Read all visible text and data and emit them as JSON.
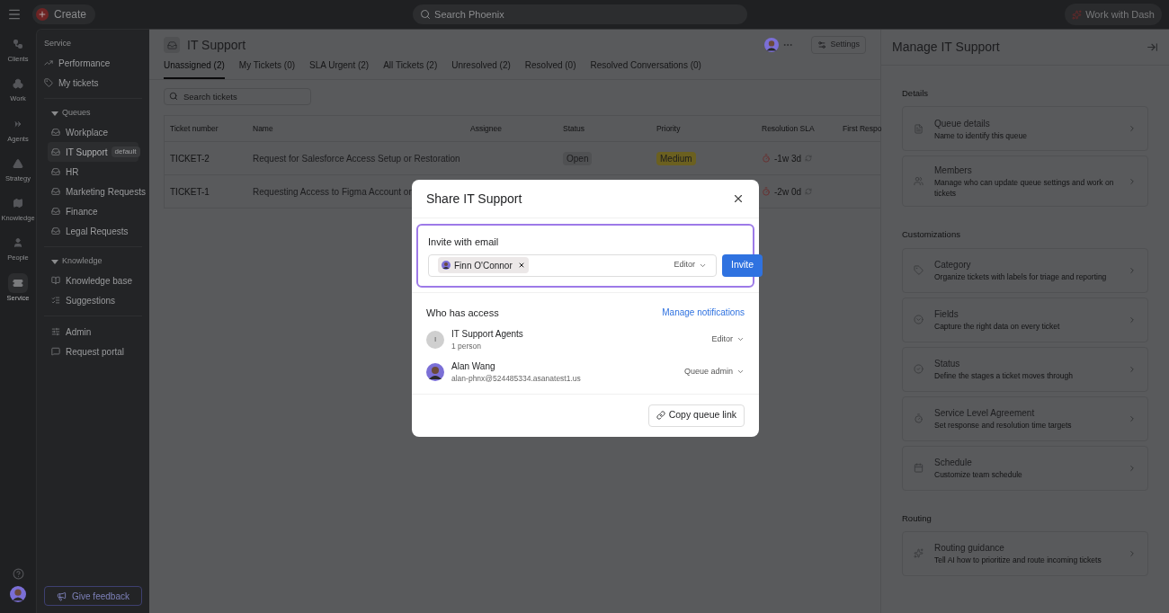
{
  "top_bar": {
    "create_label": "Create",
    "search": {
      "placeholder": "Search Phoenix"
    },
    "dash_label": "Work with Dash"
  },
  "rail": [
    {
      "label": "Clients",
      "selected": false
    },
    {
      "label": "Work",
      "selected": false
    },
    {
      "label": "Agents",
      "selected": false
    },
    {
      "label": "Strategy",
      "selected": false
    },
    {
      "label": "Knowledge",
      "selected": false
    },
    {
      "label": "People",
      "selected": false
    },
    {
      "label": "Service",
      "selected": true
    }
  ],
  "sidebar": {
    "sections": [
      {
        "title": "Service",
        "items": [
          {
            "label": "Performance",
            "selected": false
          },
          {
            "label": "My tickets",
            "selected": false
          }
        ]
      },
      {
        "title": "Queues",
        "expanded": true,
        "items": [
          {
            "label": "Workplace",
            "selected": false
          },
          {
            "label": "IT Support",
            "badge": "default",
            "selected": true
          },
          {
            "label": "HR",
            "selected": false
          },
          {
            "label": "Marketing Requests",
            "selected": false
          },
          {
            "label": "Finance",
            "selected": false
          },
          {
            "label": "Legal Requests",
            "selected": false
          }
        ]
      },
      {
        "title": "Knowledge",
        "expanded": true,
        "items": [
          {
            "label": "Knowledge base",
            "selected": false
          },
          {
            "label": "Suggestions",
            "selected": false
          }
        ]
      },
      {
        "items": [
          {
            "label": "Admin",
            "selected": false
          },
          {
            "label": "Request portal",
            "selected": false
          }
        ]
      }
    ],
    "feedback_label": "Give feedback"
  },
  "queue": {
    "title": "IT Support",
    "settings_label": "Settings",
    "tabs": [
      {
        "label": "Unassigned (2)",
        "selected": true
      },
      {
        "label": "My Tickets (0)",
        "selected": false
      },
      {
        "label": "SLA Urgent (2)",
        "selected": false
      },
      {
        "label": "All Tickets (2)",
        "selected": false
      },
      {
        "label": "Unresolved (2)",
        "selected": false
      },
      {
        "label": "Resolved (0)",
        "selected": false
      },
      {
        "label": "Resolved Conversations (0)",
        "selected": false
      }
    ],
    "search": {
      "placeholder": "Search tickets"
    },
    "table": {
      "columns": [
        "Ticket number",
        "Name",
        "Assignee",
        "Status",
        "Priority",
        "Resolution SLA",
        "First Respo"
      ],
      "rows": [
        {
          "ticket": "TICKET-2",
          "name": "Request for Salesforce Access Setup or Restoration",
          "status": "Open",
          "priority": "Medium",
          "sla": "-1w 3d"
        },
        {
          "ticket": "TICKET-1",
          "name": "Requesting Access to Figma Account or",
          "sla": "-2w 0d"
        }
      ]
    }
  },
  "manage_panel": {
    "title": "Manage IT Support",
    "sections": [
      {
        "title": "Details",
        "cards": [
          {
            "title": "Queue details",
            "description": "Name to identify this queue"
          },
          {
            "title": "Members",
            "description": "Manage who can update queue settings and work on tickets"
          }
        ]
      },
      {
        "title": "Customizations",
        "cards": [
          {
            "title": "Category",
            "description": "Organize tickets with labels for triage and reporting"
          },
          {
            "title": "Fields",
            "description": "Capture the right data on every ticket"
          },
          {
            "title": "Status",
            "description": "Define the stages a ticket moves through"
          },
          {
            "title": "Service Level Agreement",
            "description": "Set response and resolution time targets"
          },
          {
            "title": "Schedule",
            "description": "Customize team schedule"
          }
        ]
      },
      {
        "title": "Routing",
        "cards": [
          {
            "title": "Routing guidance",
            "description": "Tell AI how to prioritize and route incoming tickets"
          }
        ]
      }
    ]
  },
  "dialog": {
    "title": "Share IT Support",
    "invite_label": "Invite with email",
    "chips": [
      "Finn O'Connor"
    ],
    "role": "Editor",
    "invite_button": "Invite",
    "access_title": "Who has access",
    "manage_link": "Manage notifications",
    "members": [
      {
        "kind": "group",
        "initial": "I",
        "name": "IT Support Agents",
        "detail": "1 person",
        "role": "Editor"
      },
      {
        "kind": "person",
        "name": "Alan Wang",
        "detail": "alan-phnx@524485334.asanatest1.us",
        "role": "Queue admin"
      }
    ],
    "copy_button": "Copy queue link"
  }
}
